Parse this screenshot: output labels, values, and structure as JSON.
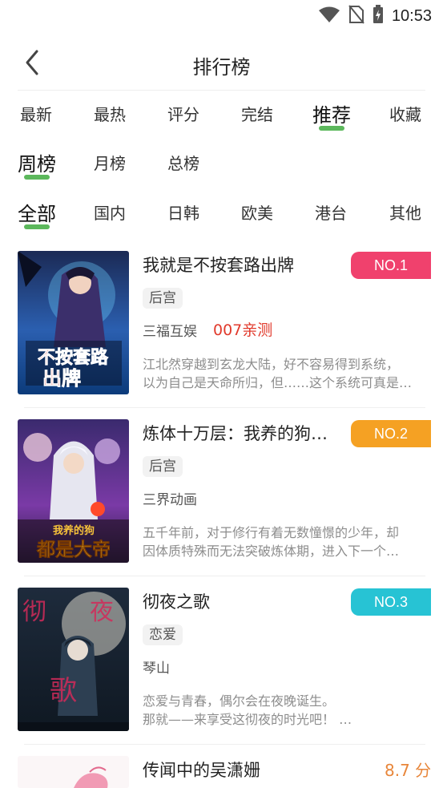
{
  "status_bar": {
    "time": "10:53"
  },
  "nav": {
    "title": "排行榜"
  },
  "category_tabs": [
    {
      "label": "最新"
    },
    {
      "label": "最热"
    },
    {
      "label": "评分"
    },
    {
      "label": "完结"
    },
    {
      "label": "推荐"
    },
    {
      "label": "收藏"
    }
  ],
  "period_tabs": [
    {
      "label": "周榜"
    },
    {
      "label": "月榜"
    },
    {
      "label": "总榜"
    }
  ],
  "region_tabs": [
    {
      "label": "全部"
    },
    {
      "label": "国内"
    },
    {
      "label": "日韩"
    },
    {
      "label": "欧美"
    },
    {
      "label": "港台"
    },
    {
      "label": "其他"
    }
  ],
  "active": {
    "category": "推荐",
    "period": "周榜",
    "region": "全部"
  },
  "colors": {
    "accent_green": "#5cb85c",
    "rank1": "#f0416d",
    "rank2": "#f5a123",
    "rank3": "#27c3d4",
    "score": "#e8863a",
    "promo": "#e13a2c"
  },
  "books": [
    {
      "title": "我就是不按套路出牌",
      "rank": "NO.1",
      "tag": "后宫",
      "author": "三福互娱",
      "promo": "007亲测",
      "desc_lines": [
        "江北然穿越到玄龙大陆，好不容易得到系统，",
        "以为自己是天命所归，但……这个系统可真是…"
      ]
    },
    {
      "title": "炼体十万层：我养的狗…",
      "rank": "NO.2",
      "tag": "后宫",
      "author": "三界动画",
      "promo": "",
      "desc_lines": [
        "五千年前，对于修行有着无数憧憬的少年，却",
        "因体质特殊而无法突破炼体期，进入下一个…"
      ]
    },
    {
      "title": "彻夜之歌",
      "rank": "NO.3",
      "tag": "恋爱",
      "author": "琴山",
      "promo": "",
      "desc_lines": [
        "恋爱与青春，偶尔会在夜晚诞生。",
        "那就——来享受这彻夜的时光吧！ …"
      ]
    },
    {
      "title": "传闻中的吴潇姗",
      "score": "8.7 分"
    }
  ]
}
